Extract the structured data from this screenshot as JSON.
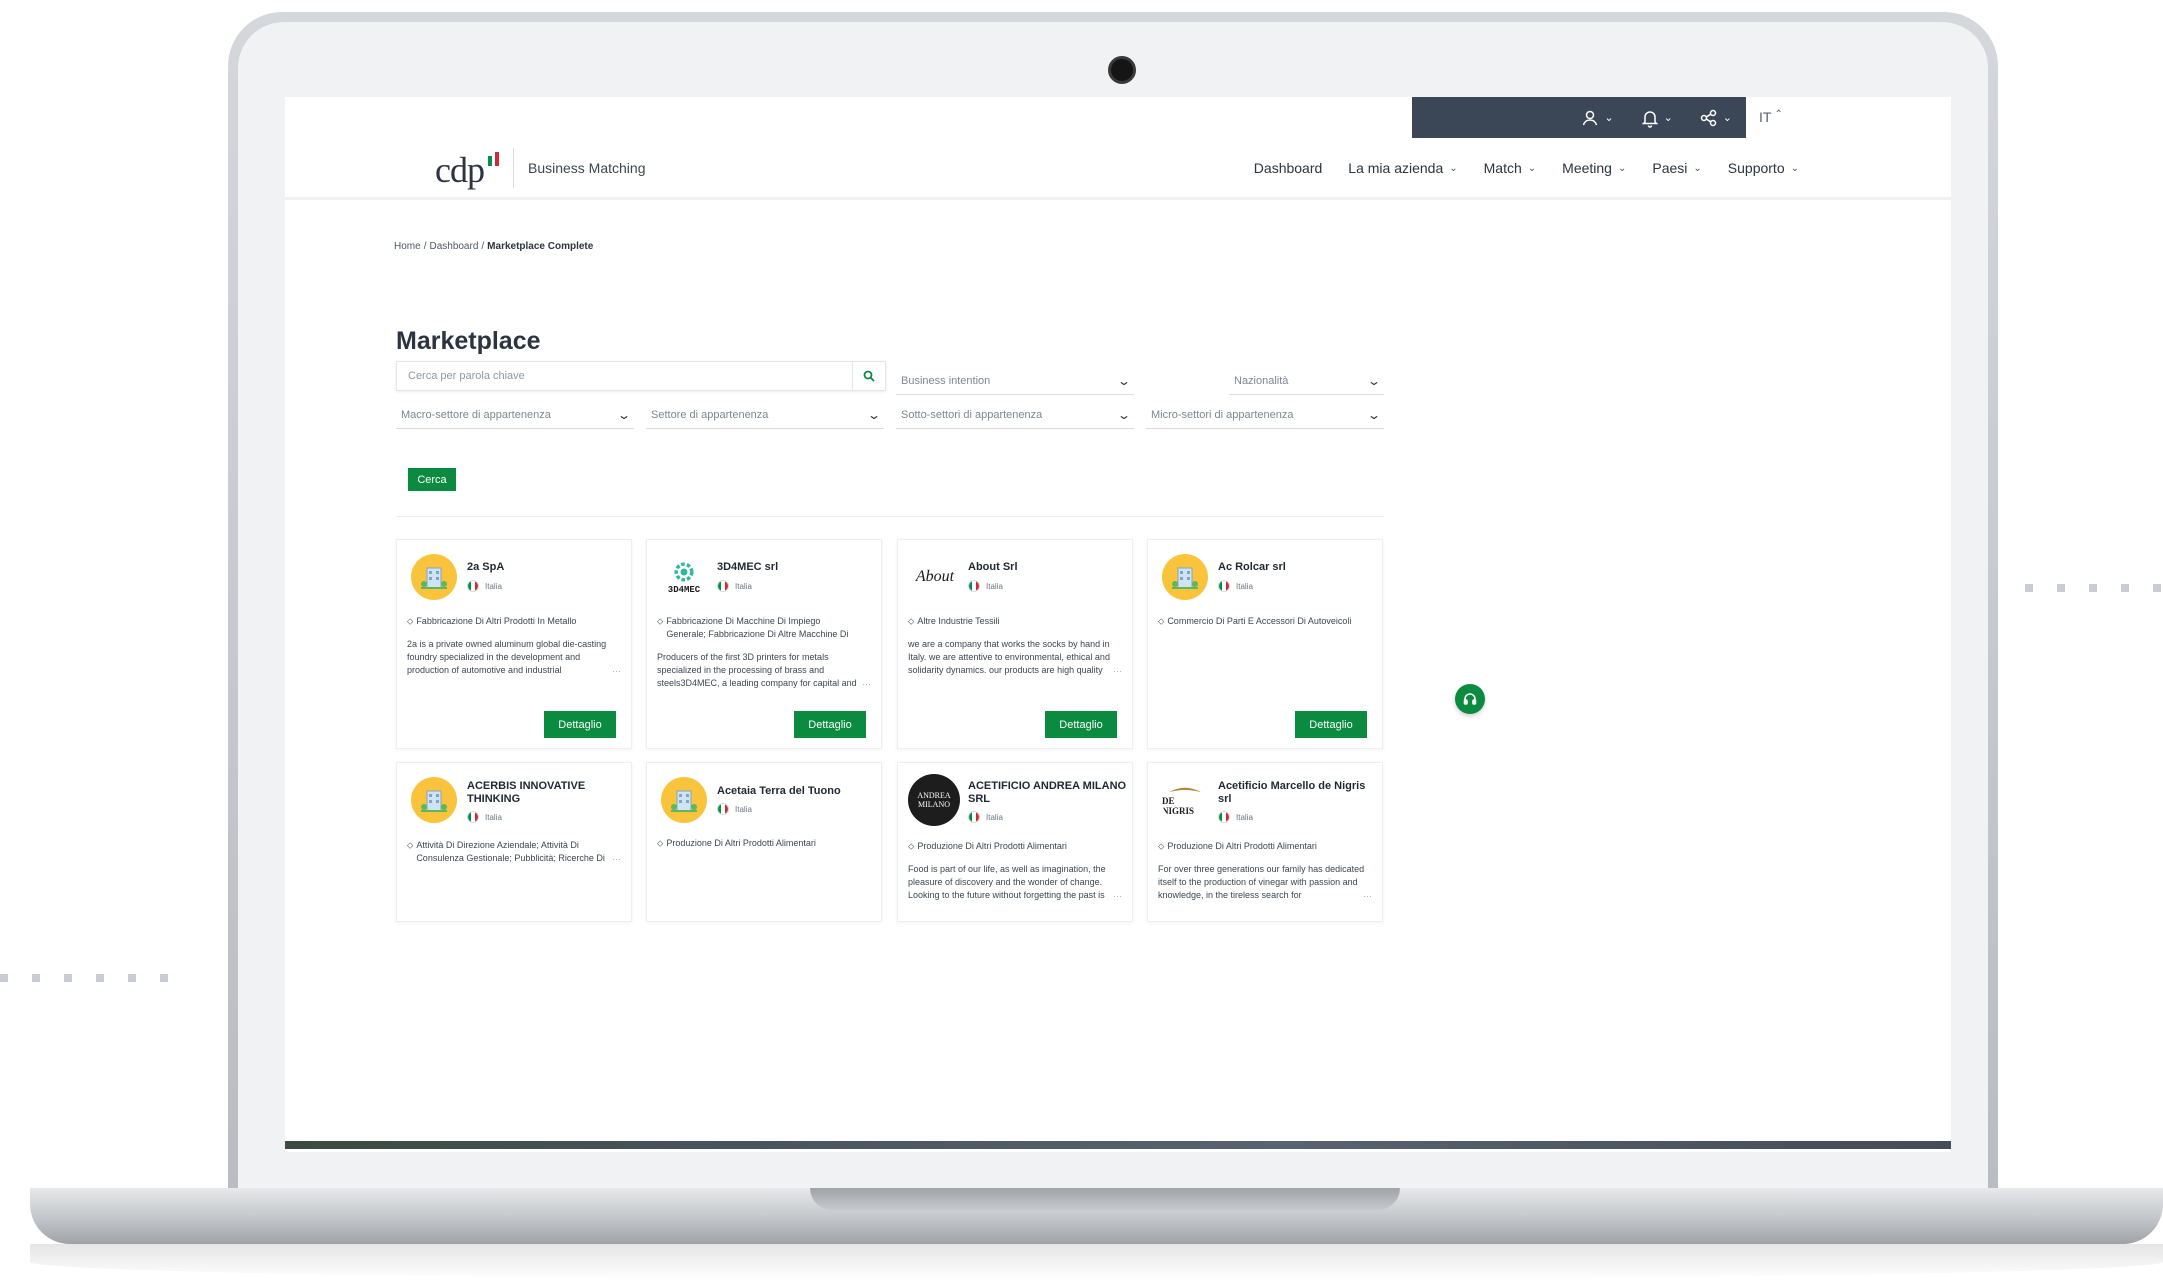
{
  "utility_bar": {
    "user_icon": "user-icon",
    "bell_icon": "bell-icon",
    "share_icon": "share-icon",
    "language": "IT"
  },
  "header": {
    "logo_text": "cdp",
    "subtitle": "Business Matching",
    "nav": [
      {
        "label": "Dashboard",
        "has_dropdown": false
      },
      {
        "label": "La mia azienda",
        "has_dropdown": true
      },
      {
        "label": "Match",
        "has_dropdown": true
      },
      {
        "label": "Meeting",
        "has_dropdown": true
      },
      {
        "label": "Paesi",
        "has_dropdown": true
      },
      {
        "label": "Supporto",
        "has_dropdown": true
      }
    ]
  },
  "breadcrumb": {
    "home": "Home",
    "dashboard": "Dashboard",
    "current": "Marketplace Complete"
  },
  "page": {
    "title": "Marketplace",
    "search_placeholder": "Cerca per parola chiave",
    "filters": {
      "business_intention": "Business intention",
      "nazionalita": "Nazionalità",
      "macro_settore": "Macro-settore di appartenenza",
      "settore": "Settore di appartenenza",
      "sotto_settori": "Sotto-settori di appartenenza",
      "micro_settori": "Micro-settori di appartenenza"
    },
    "search_button": "Cerca",
    "detail_label": "Dettaglio"
  },
  "cards": [
    {
      "name": "2a SpA",
      "country": "Italia",
      "sector": "Fabbricazione Di Altri Prodotti In Metallo",
      "description": "2a is a private owned aluminum global die-casting foundry specialized in the development and production of automotive and industrial",
      "logo": "building-logo"
    },
    {
      "name": "3D4MEC srl",
      "country": "Italia",
      "sector": "Fabbricazione Di Macchine Di Impiego Generale; Fabbricazione Di Altre Macchine Di",
      "description": "Producers of the first 3D printers for metals specialized in the processing of brass and steels3D4MEC, a leading company for capital and",
      "logo_text": "3D4MEC"
    },
    {
      "name": "About Srl",
      "country": "Italia",
      "sector": "Altre Industrie Tessili",
      "description": "we are a company that works the socks by hand in Italy. we are attentive to environmental, ethical and solidarity dynamics. our products are high quality",
      "logo_text": "About"
    },
    {
      "name": "Ac Rolcar srl",
      "country": "Italia",
      "sector": "Commercio Di Parti E Accessori Di Autoveicoli",
      "description": "",
      "logo": "building-logo"
    },
    {
      "name": "ACERBIS INNOVATIVE THINKING",
      "country": "Italia",
      "sector": "Attività Di Direzione Aziendale; Attività Di Consulenza Gestionale; Pubblicità; Ricerche Di",
      "description": "",
      "logo": "building-logo"
    },
    {
      "name": "Acetaia Terra del Tuono",
      "country": "Italia",
      "sector": "Produzione Di Altri Prodotti Alimentari",
      "description": "",
      "logo": "building-logo"
    },
    {
      "name": "ACETIFICIO ANDREA MILANO SRL",
      "country": "Italia",
      "sector": "Produzione Di Altri Prodotti Alimentari",
      "description": "Food is part of our life, as well as imagination, the pleasure of discovery and the wonder of change. Looking to the future without forgetting the past is",
      "logo_text": "ANDREA MILANO"
    },
    {
      "name": "Acetificio Marcello de Nigris srl",
      "country": "Italia",
      "sector": "Produzione Di Altri Prodotti Alimentari",
      "description": "For over three generations our family has dedicated itself to the production of vinegar with passion and knowledge, in the tireless search for",
      "logo_text": "DE NIGRIS"
    }
  ],
  "colors": {
    "primary_green": "#0a8b3f",
    "utility_bar": "#3b4757",
    "logo_yellow": "#f9c43c"
  }
}
